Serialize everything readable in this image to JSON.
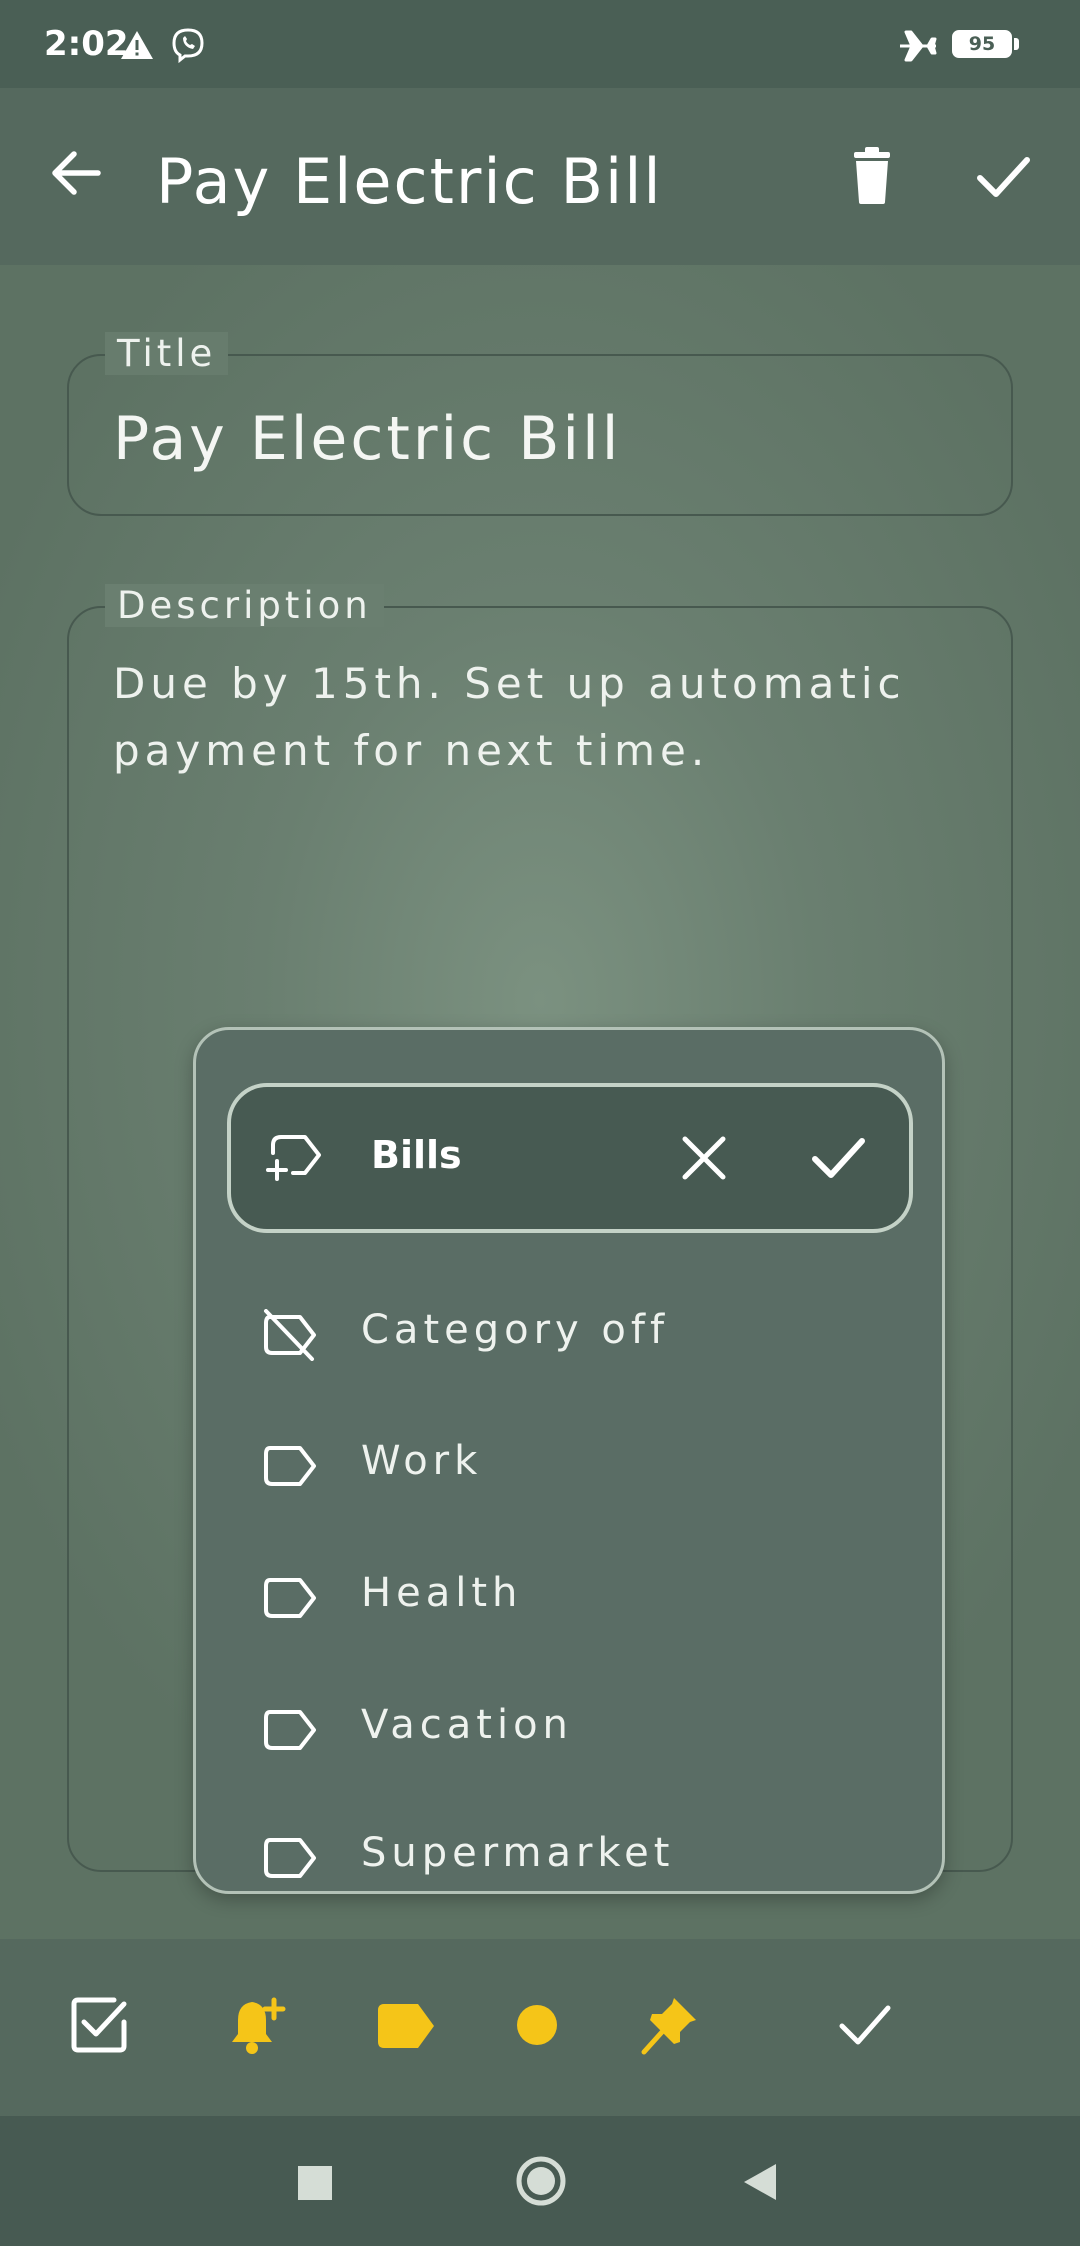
{
  "status_bar": {
    "time": "2:02",
    "battery_level": "95",
    "icons": [
      "warning-icon",
      "viber-icon",
      "airplane-mode-icon",
      "battery-icon"
    ]
  },
  "app_bar": {
    "title": "Pay Electric Bill",
    "icons": [
      "back-arrow-icon",
      "trash-icon",
      "checkmark-icon"
    ]
  },
  "title_field": {
    "label": "Title",
    "value": "Pay Electric Bill"
  },
  "description_field": {
    "label": "Description",
    "value": "Due by 15th. Set up automatic payment for next time."
  },
  "category_popup": {
    "input_value": "Bills",
    "input_icons": [
      "add-label-icon",
      "close-icon",
      "checkmark-icon"
    ],
    "items": [
      {
        "label": "Category off",
        "icon": "label-off-icon"
      },
      {
        "label": "Work",
        "icon": "label-icon"
      },
      {
        "label": "Health",
        "icon": "label-icon"
      },
      {
        "label": "Vacation",
        "icon": "label-icon"
      },
      {
        "label": "Supermarket",
        "icon": "label-icon"
      }
    ]
  },
  "bottom_toolbar": {
    "icons": [
      "checklist-icon",
      "add-reminder-icon",
      "category-tag-icon",
      "color-dot-icon",
      "pin-icon",
      "checkmark-icon"
    ],
    "accent_color": "#f5c518"
  },
  "nav_bar": {
    "icons": [
      "recents-square-icon",
      "home-circle-icon",
      "back-triangle-icon"
    ]
  },
  "colors": {
    "background": "#6a7f70",
    "bars": "#55695e",
    "popup": "#5a6d65",
    "accent_yellow": "#f5c518"
  }
}
